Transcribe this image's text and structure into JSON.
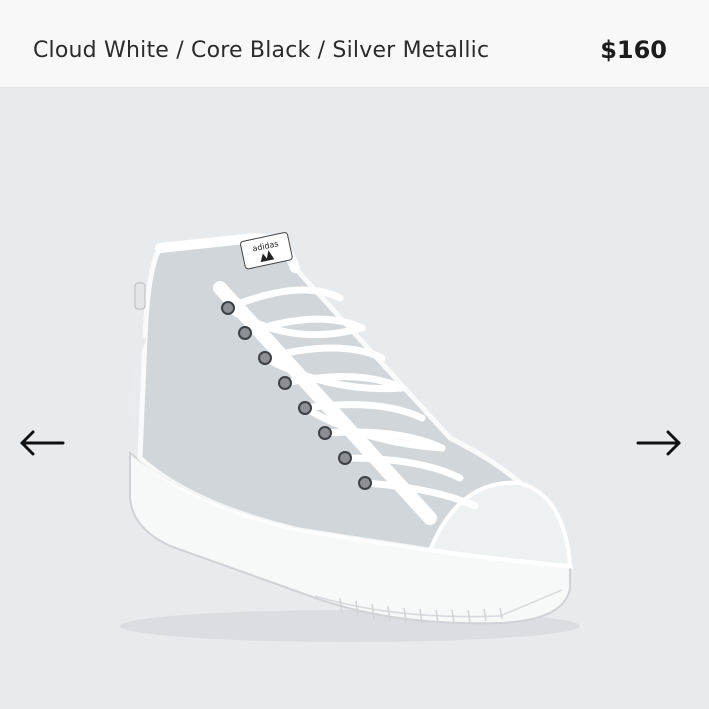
{
  "product": {
    "color_variant": "Cloud White / Core Black / Silver Metallic",
    "price": "$160",
    "brand_logo_text": "adidas"
  },
  "gallery": {
    "prev_icon": "arrow-left-icon",
    "next_icon": "arrow-right-icon",
    "image_subject": "sneaker-icon"
  },
  "colors": {
    "background": "#eceeef",
    "header_background": "#f8f8f8",
    "text": "#2b2b2b",
    "arrow": "#111111"
  }
}
